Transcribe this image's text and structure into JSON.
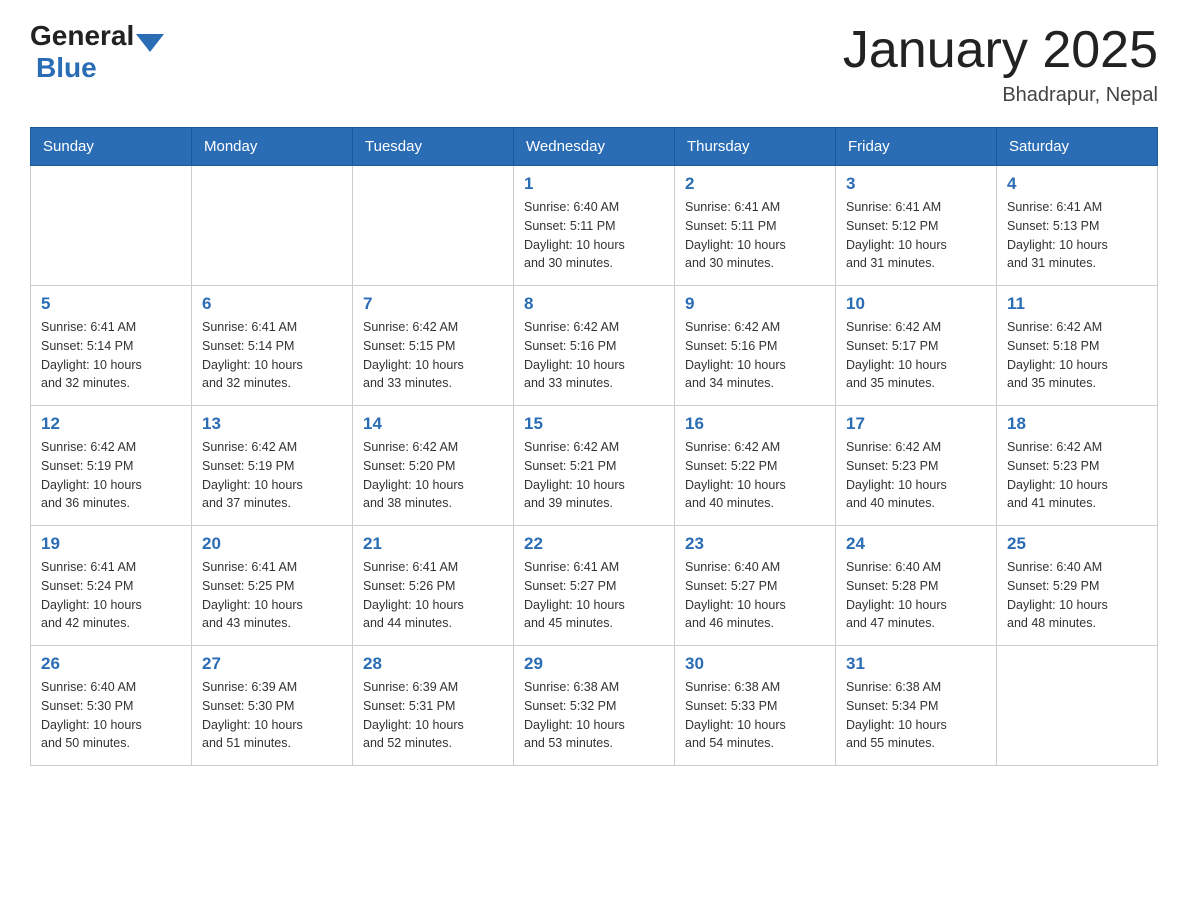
{
  "header": {
    "logo_general": "General",
    "logo_blue": "Blue",
    "month_title": "January 2025",
    "subtitle": "Bhadrapur, Nepal"
  },
  "weekdays": [
    "Sunday",
    "Monday",
    "Tuesday",
    "Wednesday",
    "Thursday",
    "Friday",
    "Saturday"
  ],
  "weeks": [
    [
      {
        "date": "",
        "info": ""
      },
      {
        "date": "",
        "info": ""
      },
      {
        "date": "",
        "info": ""
      },
      {
        "date": "1",
        "info": "Sunrise: 6:40 AM\nSunset: 5:11 PM\nDaylight: 10 hours\nand 30 minutes."
      },
      {
        "date": "2",
        "info": "Sunrise: 6:41 AM\nSunset: 5:11 PM\nDaylight: 10 hours\nand 30 minutes."
      },
      {
        "date": "3",
        "info": "Sunrise: 6:41 AM\nSunset: 5:12 PM\nDaylight: 10 hours\nand 31 minutes."
      },
      {
        "date": "4",
        "info": "Sunrise: 6:41 AM\nSunset: 5:13 PM\nDaylight: 10 hours\nand 31 minutes."
      }
    ],
    [
      {
        "date": "5",
        "info": "Sunrise: 6:41 AM\nSunset: 5:14 PM\nDaylight: 10 hours\nand 32 minutes."
      },
      {
        "date": "6",
        "info": "Sunrise: 6:41 AM\nSunset: 5:14 PM\nDaylight: 10 hours\nand 32 minutes."
      },
      {
        "date": "7",
        "info": "Sunrise: 6:42 AM\nSunset: 5:15 PM\nDaylight: 10 hours\nand 33 minutes."
      },
      {
        "date": "8",
        "info": "Sunrise: 6:42 AM\nSunset: 5:16 PM\nDaylight: 10 hours\nand 33 minutes."
      },
      {
        "date": "9",
        "info": "Sunrise: 6:42 AM\nSunset: 5:16 PM\nDaylight: 10 hours\nand 34 minutes."
      },
      {
        "date": "10",
        "info": "Sunrise: 6:42 AM\nSunset: 5:17 PM\nDaylight: 10 hours\nand 35 minutes."
      },
      {
        "date": "11",
        "info": "Sunrise: 6:42 AM\nSunset: 5:18 PM\nDaylight: 10 hours\nand 35 minutes."
      }
    ],
    [
      {
        "date": "12",
        "info": "Sunrise: 6:42 AM\nSunset: 5:19 PM\nDaylight: 10 hours\nand 36 minutes."
      },
      {
        "date": "13",
        "info": "Sunrise: 6:42 AM\nSunset: 5:19 PM\nDaylight: 10 hours\nand 37 minutes."
      },
      {
        "date": "14",
        "info": "Sunrise: 6:42 AM\nSunset: 5:20 PM\nDaylight: 10 hours\nand 38 minutes."
      },
      {
        "date": "15",
        "info": "Sunrise: 6:42 AM\nSunset: 5:21 PM\nDaylight: 10 hours\nand 39 minutes."
      },
      {
        "date": "16",
        "info": "Sunrise: 6:42 AM\nSunset: 5:22 PM\nDaylight: 10 hours\nand 40 minutes."
      },
      {
        "date": "17",
        "info": "Sunrise: 6:42 AM\nSunset: 5:23 PM\nDaylight: 10 hours\nand 40 minutes."
      },
      {
        "date": "18",
        "info": "Sunrise: 6:42 AM\nSunset: 5:23 PM\nDaylight: 10 hours\nand 41 minutes."
      }
    ],
    [
      {
        "date": "19",
        "info": "Sunrise: 6:41 AM\nSunset: 5:24 PM\nDaylight: 10 hours\nand 42 minutes."
      },
      {
        "date": "20",
        "info": "Sunrise: 6:41 AM\nSunset: 5:25 PM\nDaylight: 10 hours\nand 43 minutes."
      },
      {
        "date": "21",
        "info": "Sunrise: 6:41 AM\nSunset: 5:26 PM\nDaylight: 10 hours\nand 44 minutes."
      },
      {
        "date": "22",
        "info": "Sunrise: 6:41 AM\nSunset: 5:27 PM\nDaylight: 10 hours\nand 45 minutes."
      },
      {
        "date": "23",
        "info": "Sunrise: 6:40 AM\nSunset: 5:27 PM\nDaylight: 10 hours\nand 46 minutes."
      },
      {
        "date": "24",
        "info": "Sunrise: 6:40 AM\nSunset: 5:28 PM\nDaylight: 10 hours\nand 47 minutes."
      },
      {
        "date": "25",
        "info": "Sunrise: 6:40 AM\nSunset: 5:29 PM\nDaylight: 10 hours\nand 48 minutes."
      }
    ],
    [
      {
        "date": "26",
        "info": "Sunrise: 6:40 AM\nSunset: 5:30 PM\nDaylight: 10 hours\nand 50 minutes."
      },
      {
        "date": "27",
        "info": "Sunrise: 6:39 AM\nSunset: 5:30 PM\nDaylight: 10 hours\nand 51 minutes."
      },
      {
        "date": "28",
        "info": "Sunrise: 6:39 AM\nSunset: 5:31 PM\nDaylight: 10 hours\nand 52 minutes."
      },
      {
        "date": "29",
        "info": "Sunrise: 6:38 AM\nSunset: 5:32 PM\nDaylight: 10 hours\nand 53 minutes."
      },
      {
        "date": "30",
        "info": "Sunrise: 6:38 AM\nSunset: 5:33 PM\nDaylight: 10 hours\nand 54 minutes."
      },
      {
        "date": "31",
        "info": "Sunrise: 6:38 AM\nSunset: 5:34 PM\nDaylight: 10 hours\nand 55 minutes."
      },
      {
        "date": "",
        "info": ""
      }
    ]
  ]
}
